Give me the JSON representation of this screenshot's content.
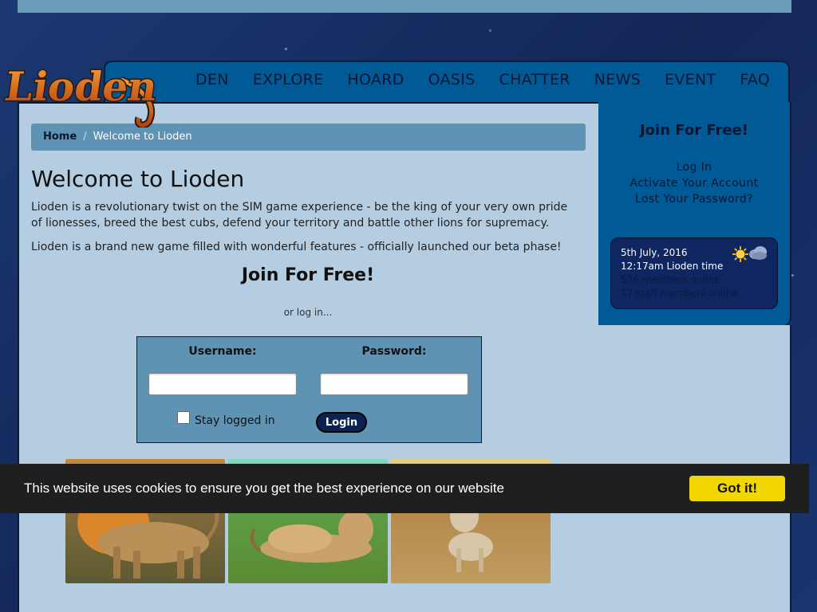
{
  "nav": [
    "DEN",
    "EXPLORE",
    "HOARD",
    "OASIS",
    "CHATTER",
    "NEWS",
    "EVENT",
    "FAQ"
  ],
  "logo_text": "Lioden",
  "breadcrumb": {
    "home": "Home",
    "separator": "/",
    "current": "Welcome to Lioden"
  },
  "main": {
    "title": "Welcome to Lioden",
    "para1": "Lioden is a revolutionary twist on the SIM game experience - be the king of your very own pride of lionesses, breed the best cubs, defend your territory and battle other lions for supremacy.",
    "para2": "Lioden is a brand new game filled with wonderful features - officially launched our beta phase!",
    "join": "Join For Free!",
    "or_login": "or log in..."
  },
  "login": {
    "username_label": "Username:",
    "password_label": "Password:",
    "username_value": "",
    "password_value": "",
    "stay_logged_in": "Stay logged in",
    "stay_checked": false,
    "button": "Login"
  },
  "sidebar": {
    "join": "Join For Free!",
    "links": [
      "Log In",
      "Activate Your Account",
      "Lost Your Password?"
    ],
    "date": "5th July, 2016",
    "time": "12:17am Lioden time",
    "members_online": "536 members online",
    "staff_online": "17 staff members online",
    "weather_icons": [
      "sun-icon",
      "cloud-icon"
    ]
  },
  "cookie": {
    "text": "This website uses cookies to ensure you get the best experience on our website",
    "button": "Got it!"
  },
  "colors": {
    "nav_bg": "#005a96",
    "content_bg": "#b4cde1",
    "breadcrumb_bg": "#5f93b3",
    "cookie_bg": "#1f1f1f",
    "cookie_button": "#f1d600",
    "login_button": "#0a2350"
  }
}
